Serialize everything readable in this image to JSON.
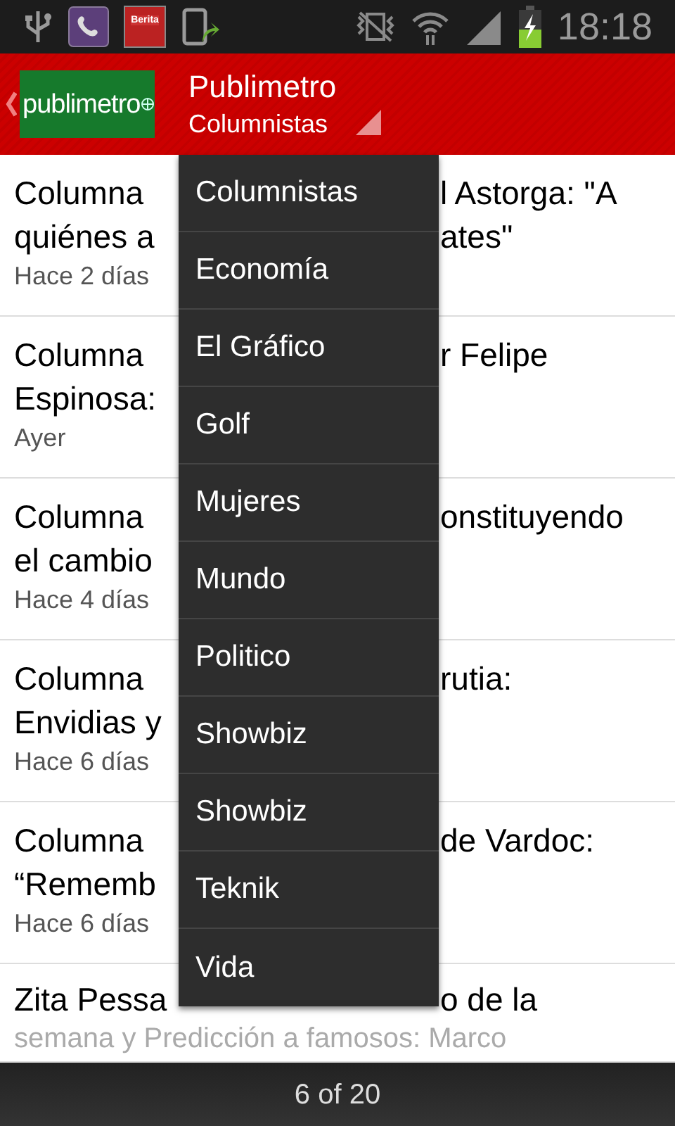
{
  "status_bar": {
    "app_icon_text": "Berita",
    "time": "18:18"
  },
  "action_bar": {
    "logo": "publimetro",
    "title": "Publimetro",
    "subtitle": "Columnistas"
  },
  "articles": [
    {
      "lines": [
        {
          "left": "Columna",
          "right": "l Astorga: \"A"
        },
        {
          "left": "quiénes a",
          "right": "ates\""
        }
      ],
      "date": "Hace 2 días"
    },
    {
      "lines": [
        {
          "left": "Columna",
          "right": "r Felipe"
        },
        {
          "left": "Espinosa:"
        }
      ],
      "date": "Ayer"
    },
    {
      "lines": [
        {
          "left": "Columna",
          "right": "onstituyendo"
        },
        {
          "left": "el cambio"
        }
      ],
      "date": "Hace 4 días"
    },
    {
      "lines": [
        {
          "left": "Columna",
          "right": "rutia:"
        },
        {
          "left": "Envidias y"
        }
      ],
      "date": "Hace 6 días"
    },
    {
      "lines": [
        {
          "left": "Columna",
          "right": "de Vardoc:"
        },
        {
          "left": "“Rememb"
        }
      ],
      "date": "Hace 6 días"
    },
    {
      "lines": [
        {
          "left": "Zita Pessa",
          "right": "o de la"
        }
      ],
      "faded_line": "semana y Predicción a famosos: Marco"
    }
  ],
  "dropdown": [
    "Columnistas",
    "Economía",
    "El Gráfico",
    "Golf",
    "Mujeres",
    "Mundo",
    "Politico",
    "Showbiz",
    "Showbiz",
    "Teknik",
    "Vida"
  ],
  "pager": "6 of 20"
}
